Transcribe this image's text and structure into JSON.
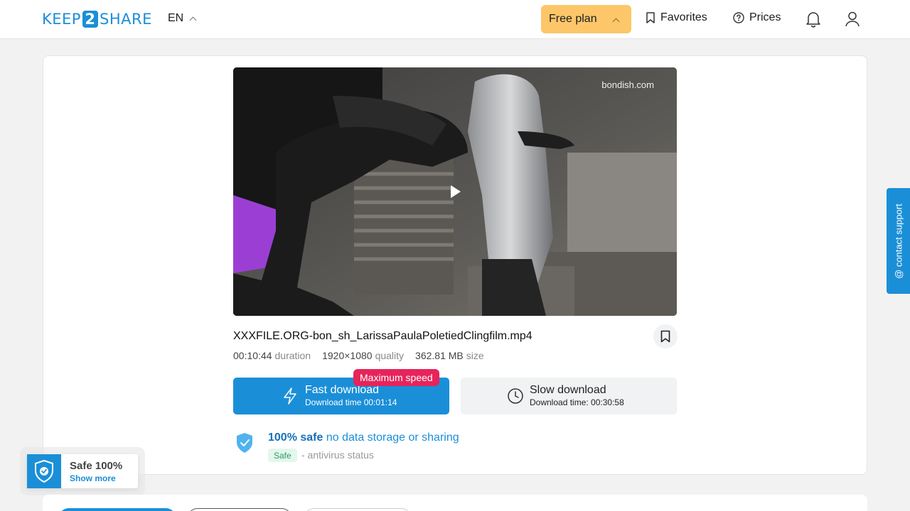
{
  "header": {
    "logo_left": "KEEP",
    "logo_mid": "2",
    "logo_right": "SHARE",
    "language": "EN",
    "plan": "Free plan",
    "favorites": "Favorites",
    "prices": "Prices"
  },
  "video": {
    "watermark": "bondish.com"
  },
  "file": {
    "name": "XXXFILE.ORG-bon_sh_LarissaPaulaPoletiedClingfilm.mp4",
    "duration_value": "00:10:44",
    "duration_label": "duration",
    "quality_value": "1920×1080",
    "quality_label": "quality",
    "size_value": "362.81 MB",
    "size_label": "size"
  },
  "download": {
    "badge": "Maximum speed",
    "fast_label": "Fast download",
    "fast_time": "Download time 00:01:14",
    "slow_label": "Slow download",
    "slow_time": "Download time: 00:30:58"
  },
  "safety": {
    "bold": "100% safe",
    "text": "no data storage or sharing",
    "status_pill": "Safe",
    "status_text": "- antivirus status"
  },
  "support": {
    "label": "@ contact support"
  },
  "safe_widget": {
    "title": "Safe 100%",
    "link": "Show more"
  },
  "colors": {
    "accent": "#1a8fd8",
    "plan_bg": "#fdc669",
    "badge": "#e6245a"
  }
}
